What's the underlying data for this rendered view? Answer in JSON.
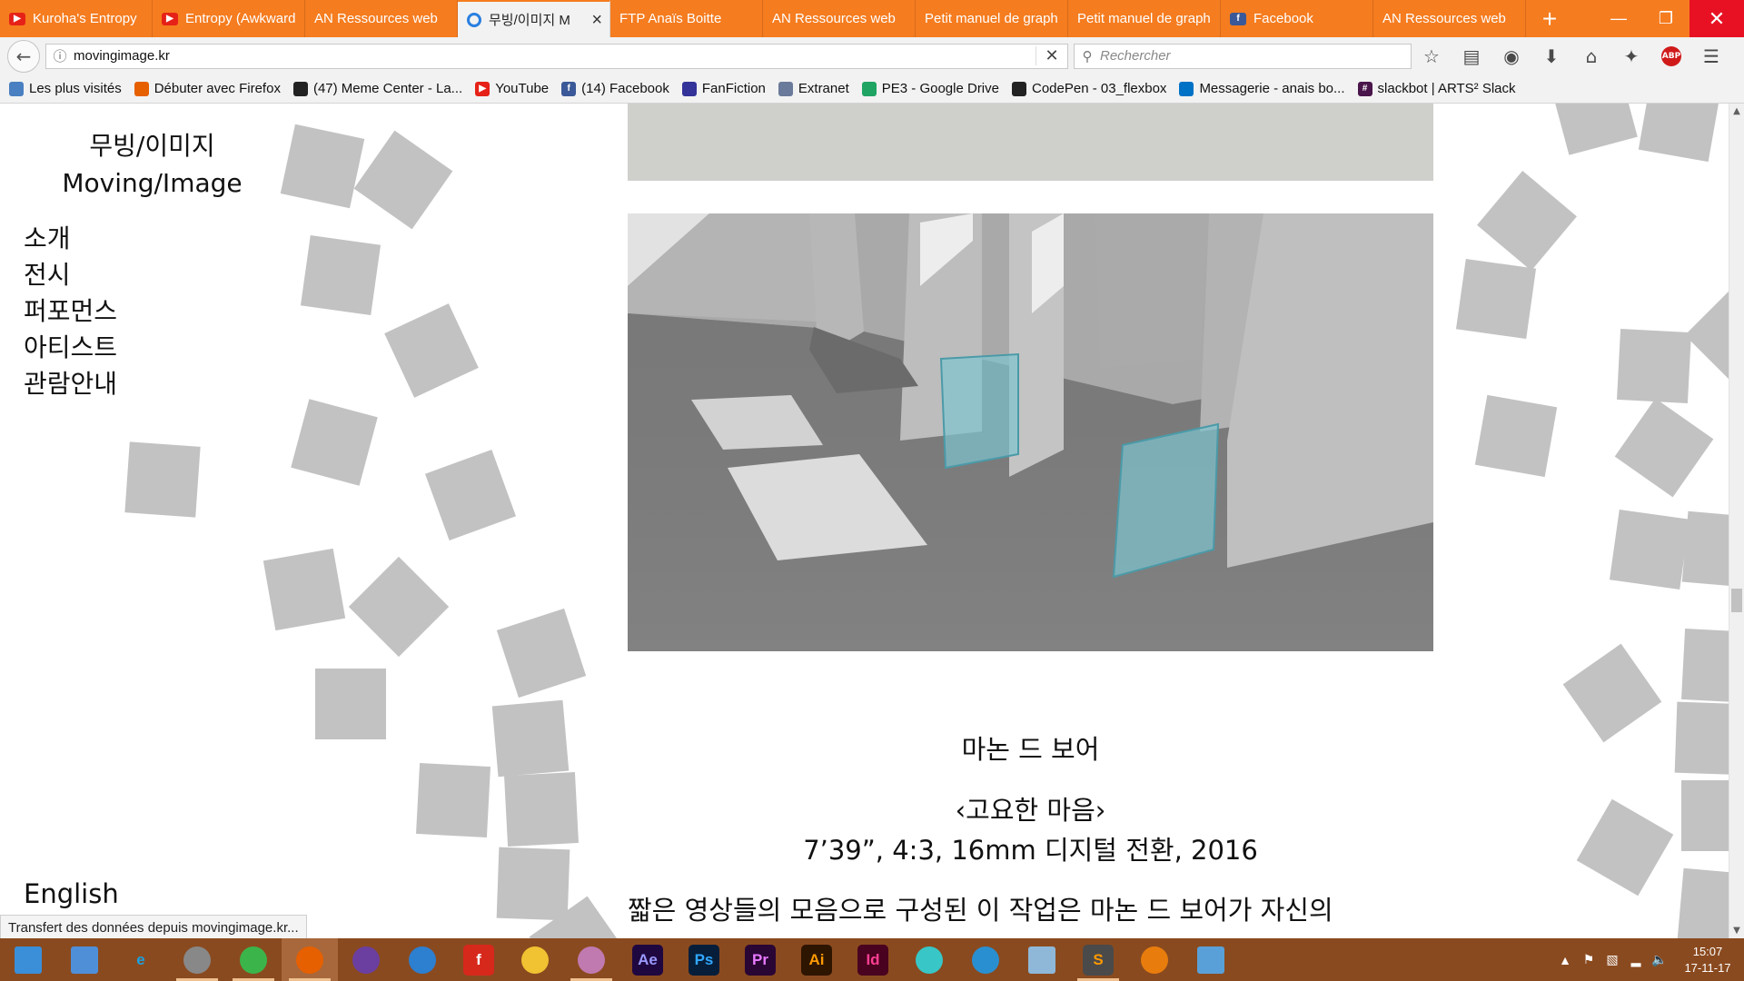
{
  "browser": {
    "tabs": [
      {
        "label": "Kuroha's Entropy",
        "icon": "youtube-icon",
        "color": "#e62117",
        "active": false
      },
      {
        "label": "Entropy (Awkward",
        "icon": "youtube-icon",
        "color": "#e62117",
        "active": false
      },
      {
        "label": "AN Ressources web",
        "icon": "",
        "color": "",
        "active": false
      },
      {
        "label": "무빙/이미지 M",
        "icon": "loading-icon",
        "color": "#2a7fe0",
        "active": true
      },
      {
        "label": "FTP Anaïs Boitte",
        "icon": "",
        "color": "",
        "active": false
      },
      {
        "label": "AN Ressources web",
        "icon": "",
        "color": "",
        "active": false
      },
      {
        "label": "Petit manuel de graph",
        "icon": "",
        "color": "",
        "active": false
      },
      {
        "label": "Petit manuel de graph",
        "icon": "",
        "color": "",
        "active": false
      },
      {
        "label": "Facebook",
        "icon": "facebook-icon",
        "color": "#3b5998",
        "active": false
      },
      {
        "label": "AN Ressources web",
        "icon": "",
        "color": "",
        "active": false
      }
    ],
    "new_tab": "+",
    "window_controls": {
      "minimize": "—",
      "maximize": "❐",
      "close": "✕"
    },
    "url": "movingimage.kr",
    "search_placeholder": "Rechercher",
    "bookmarks": [
      {
        "label": "Les plus visités",
        "icon": "bookmark-folder-icon",
        "color": "#4a7fc1"
      },
      {
        "label": "Débuter avec Firefox",
        "icon": "firefox-icon",
        "color": "#e66000"
      },
      {
        "label": "(47) Meme Center - La...",
        "icon": "memecenter-icon",
        "color": "#222222"
      },
      {
        "label": "YouTube",
        "icon": "youtube-icon",
        "color": "#e62117"
      },
      {
        "label": "(14) Facebook",
        "icon": "facebook-icon",
        "color": "#3b5998"
      },
      {
        "label": "FanFiction",
        "icon": "fanfiction-icon",
        "color": "#333399"
      },
      {
        "label": "Extranet",
        "icon": "extranet-icon",
        "color": "#6a7a9a"
      },
      {
        "label": "PE3 - Google Drive",
        "icon": "google-drive-icon",
        "color": "#1fa463"
      },
      {
        "label": "CodePen - 03_flexbox",
        "icon": "codepen-icon",
        "color": "#222222"
      },
      {
        "label": "Messagerie - anais bo...",
        "icon": "outlook-icon",
        "color": "#0072c6"
      },
      {
        "label": "slackbot | ARTS² Slack",
        "icon": "slack-icon",
        "color": "#4a154b"
      }
    ],
    "status_text": "Transfert des données depuis movingimage.kr..."
  },
  "page": {
    "title_ko": "무빙/이미지",
    "title_en": "Moving/Image",
    "menu": [
      "소개",
      "전시",
      "퍼포먼스",
      "아티스트",
      "관람안내"
    ],
    "language_link": "English",
    "artist": "마논 드 보어",
    "work_title": "‹고요한 마음›",
    "work_meta": "7’39”, 4:3, 16mm 디지털 전환, 2016",
    "description": "짧은 영상들의 모음으로 구성된 이 작업은 마논 드 보어가 자신의"
  },
  "taskbar": {
    "apps": [
      {
        "name": "start-icon",
        "label": "",
        "bg": "",
        "fg": "#ffffff"
      },
      {
        "name": "task-view-icon",
        "label": "",
        "bg": "",
        "fg": "#ffffff"
      },
      {
        "name": "internet-explorer-icon",
        "label": "e",
        "bg": "",
        "fg": "#1ba1e2"
      },
      {
        "name": "file-explorer-icon",
        "label": "",
        "bg": "#f2c94c",
        "fg": "#ffffff"
      },
      {
        "name": "chrome-icon",
        "label": "",
        "bg": "",
        "fg": "#ffffff"
      },
      {
        "name": "firefox-icon",
        "label": "",
        "bg": "",
        "fg": "#ffffff"
      },
      {
        "name": "audio-app-icon",
        "label": "",
        "bg": "",
        "fg": "#ffffff"
      },
      {
        "name": "thunderbird-icon",
        "label": "",
        "bg": "",
        "fg": "#ffffff"
      },
      {
        "name": "flash-icon",
        "label": "f",
        "bg": "#d7281c",
        "fg": "#ffffff"
      },
      {
        "name": "cyberduck-icon",
        "label": "",
        "bg": "",
        "fg": "#ffffff"
      },
      {
        "name": "paint-app-icon",
        "label": "",
        "bg": "",
        "fg": "#ffffff"
      },
      {
        "name": "after-effects-icon",
        "label": "Ae",
        "bg": "#1f0740",
        "fg": "#9a9aff"
      },
      {
        "name": "photoshop-icon",
        "label": "Ps",
        "bg": "#061e3a",
        "fg": "#31a8ff"
      },
      {
        "name": "premiere-icon",
        "label": "Pr",
        "bg": "#2a0634",
        "fg": "#e77bff"
      },
      {
        "name": "illustrator-icon",
        "label": "Ai",
        "bg": "#2e1500",
        "fg": "#ff9a00"
      },
      {
        "name": "indesign-icon",
        "label": "Id",
        "bg": "#49021f",
        "fg": "#ff3f94"
      },
      {
        "name": "anime-app-icon",
        "label": "",
        "bg": "",
        "fg": "#ffffff"
      },
      {
        "name": "mmd-app-icon",
        "label": "",
        "bg": "",
        "fg": "#ffffff"
      },
      {
        "name": "monitor-app-icon",
        "label": "",
        "bg": "",
        "fg": "#ffffff"
      },
      {
        "name": "sublime-text-icon",
        "label": "S",
        "bg": "#4a4a4a",
        "fg": "#ff9800"
      },
      {
        "name": "blender-icon",
        "label": "",
        "bg": "",
        "fg": "#ffffff"
      },
      {
        "name": "control-panel-icon",
        "label": "",
        "bg": "",
        "fg": "#ffffff"
      }
    ],
    "clock_time": "15:07",
    "clock_date": "17-11-17"
  }
}
